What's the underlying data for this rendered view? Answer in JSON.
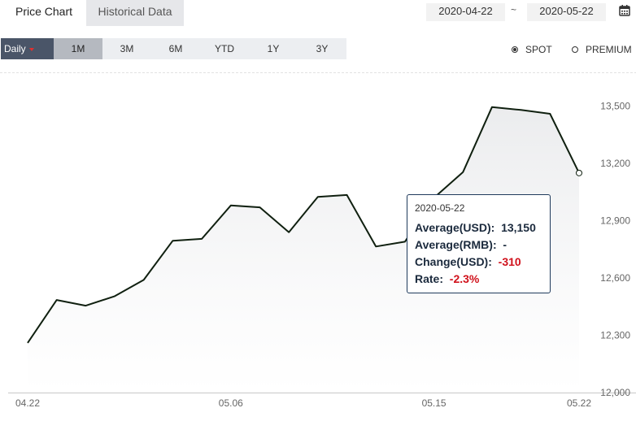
{
  "tabs": [
    {
      "label": "Price Chart",
      "active": true
    },
    {
      "label": "Historical Data",
      "active": false
    }
  ],
  "date_range": {
    "from": "2020-04-22",
    "separator": "~",
    "to": "2020-05-22"
  },
  "periods": [
    {
      "label": "Daily",
      "kind": "daily"
    },
    {
      "label": "1M",
      "kind": "active"
    },
    {
      "label": "3M",
      "kind": ""
    },
    {
      "label": "6M",
      "kind": ""
    },
    {
      "label": "YTD",
      "kind": ""
    },
    {
      "label": "1Y",
      "kind": ""
    },
    {
      "label": "3Y",
      "kind": ""
    }
  ],
  "price_type": {
    "options": [
      "SPOT",
      "PREMIUM"
    ],
    "selected": "SPOT"
  },
  "tooltip": {
    "date": "2020-05-22",
    "avg_usd_label": "Average(USD):",
    "avg_usd_value": "13,150",
    "avg_rmb_label": "Average(RMB):",
    "avg_rmb_value": "-",
    "change_label": "Change(USD):",
    "change_value": "-310",
    "rate_label": "Rate:",
    "rate_value": "-2.3%"
  },
  "colors": {
    "line": "#102010",
    "accent_negative": "#d0111b",
    "selected_period": "#4a5568"
  },
  "chart_data": {
    "type": "area",
    "x": [
      "04.22",
      "04.23",
      "04.24",
      "04.27",
      "04.28",
      "04.29",
      "04.30",
      "05.06",
      "05.07",
      "05.08",
      "05.11",
      "05.12",
      "05.13",
      "05.14",
      "05.15",
      "05.18",
      "05.19",
      "05.20",
      "05.21",
      "05.22"
    ],
    "series": [
      {
        "values": [
          12260,
          12485,
          12455,
          12505,
          12590,
          12795,
          12805,
          12980,
          12970,
          12840,
          13025,
          13035,
          12765,
          12790,
          13020,
          13155,
          13495,
          13480,
          13460,
          13150
        ]
      }
    ],
    "xtick_labels": [
      "04.22",
      "05.06",
      "05.15",
      "05.22"
    ],
    "yticks": [
      12000,
      12300,
      12600,
      12900,
      13200,
      13500
    ],
    "ytick_labels": [
      "12,000",
      "12,300",
      "12,600",
      "12,900",
      "13,200",
      "13,500"
    ],
    "ylim": [
      12000,
      13575
    ],
    "grid": false
  }
}
